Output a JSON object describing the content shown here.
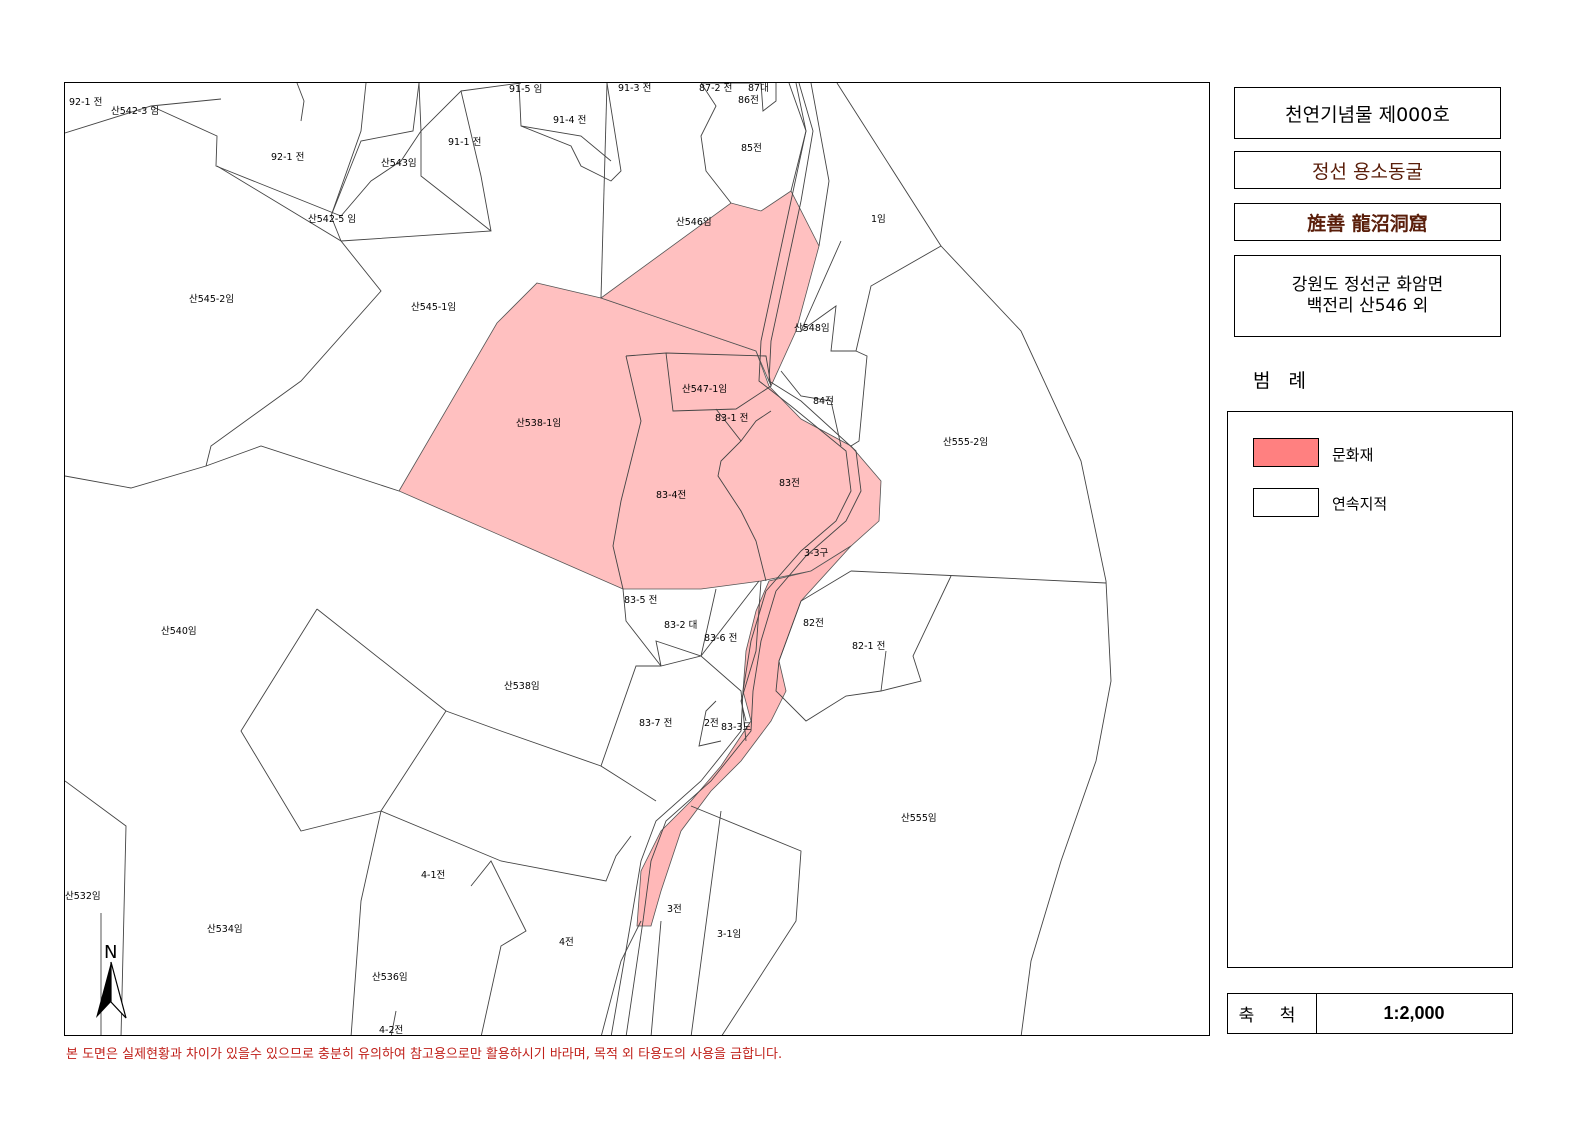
{
  "title": "천연기념물 제000호",
  "name_korean": "정선 용소동굴",
  "name_hanja": "旌善 龍沼洞窟",
  "address": {
    "line1": "강원도 정선군 화암면",
    "line2": "백전리 산546 외"
  },
  "legend": {
    "title": "범 례",
    "items": [
      {
        "label": "문화재",
        "color": "#ff8080"
      },
      {
        "label": "연속지적",
        "color": "#ffffff"
      }
    ]
  },
  "scale": {
    "label": "축 척",
    "value": "1:2,000"
  },
  "north_label": "N",
  "disclaimer": "본 도면은 실제현황과 차이가 있을수 있으므로 충분히 유의하여 참고용으로만 활용하시기 바라며, 목적 외 타용도의 사용을 금합니다.",
  "colors": {
    "heritage_fill": "#ffc0c0",
    "heritage_stream": "#f4a8a8",
    "disclaimer_text": "#c0201a"
  },
  "parcels": [
    "92-1 전",
    "산542-3 임",
    "92-1 전",
    "산543임",
    "91-5 임",
    "91-3 전",
    "87-2 전",
    "87대",
    "86전",
    "91-4 전",
    "91-1 전",
    "85전",
    "산542-5 임",
    "산546임",
    "1임",
    "산545-2임",
    "산545-1임",
    "산548임",
    "산547-1임",
    "84전",
    "83-1 전",
    "산538-1임",
    "산555-2임",
    "83전",
    "83-4전",
    "3-3구",
    "83-5 전",
    "83-2 대",
    "83-6 전",
    "82전",
    "82-1 전",
    "산540임",
    "산538임",
    "83-7 전",
    "2전",
    "83-3도",
    "산555임",
    "4-1전",
    "산532임",
    "산534임",
    "3전",
    "3-1임",
    "4전",
    "산536임",
    "4-2전"
  ]
}
